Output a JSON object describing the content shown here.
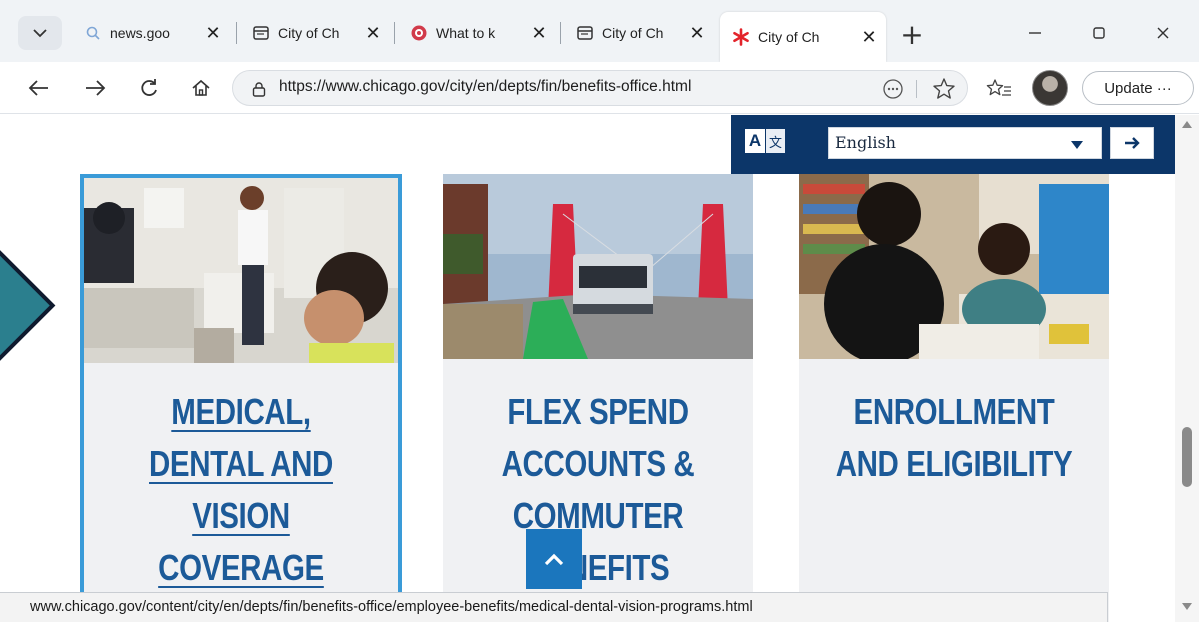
{
  "browser": {
    "tabs": [
      {
        "title": "news.goo",
        "icon": "search-icon",
        "active": false
      },
      {
        "title": "City of Ch",
        "icon": "page-icon",
        "active": false
      },
      {
        "title": "What to k",
        "icon": "brand-icon",
        "active": false
      },
      {
        "title": "City of Ch",
        "icon": "page-icon",
        "active": false
      },
      {
        "title": "City of Ch",
        "icon": "chicago-star-icon",
        "active": true
      }
    ],
    "url": "https://www.chicago.gov/city/en/depts/fin/benefits-office.html",
    "update_label": "Update",
    "update_more": "···",
    "status_url": "www.chicago.gov/content/city/en/depts/fin/benefits-office/employee-benefits/medical-dental-vision-programs.html"
  },
  "translate": {
    "selected_language": "English"
  },
  "cards": [
    {
      "title": "MEDICAL, DENTAL AND VISION COVERAGE",
      "focused": true
    },
    {
      "title": "FLEX SPEND ACCOUNTS & COMMUTER BENEFITS",
      "focused": false
    },
    {
      "title": "ENROLLMENT AND ELIGIBILITY",
      "focused": false
    }
  ],
  "colors": {
    "brand_blue": "#1c5a98",
    "translate_bar": "#0c3669",
    "focus_border": "#3a9bd8",
    "back_to_top": "#1b76bd",
    "side_arrow": "#2b7f8e"
  }
}
